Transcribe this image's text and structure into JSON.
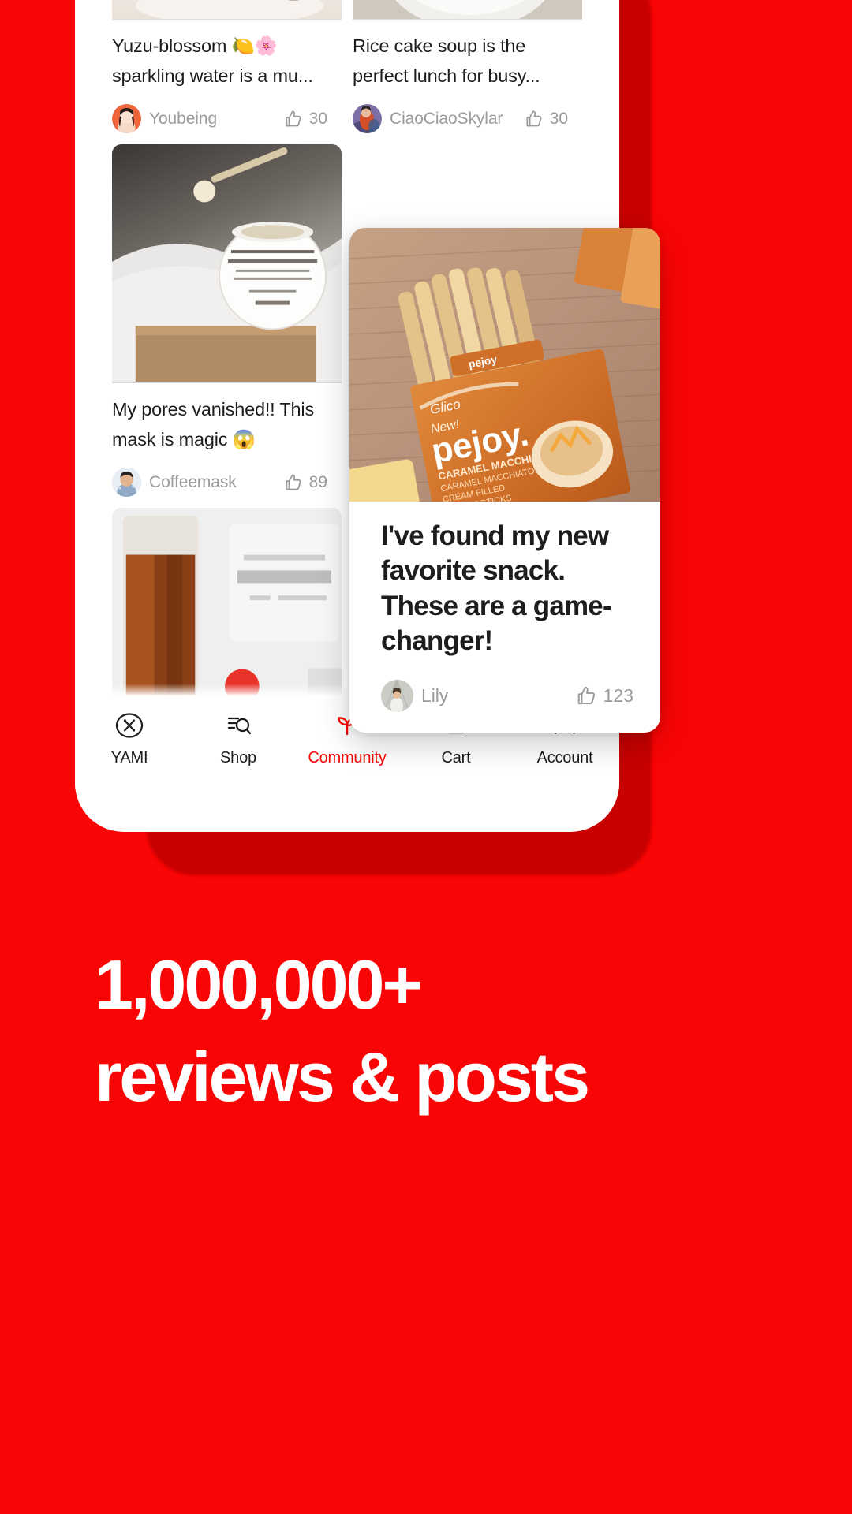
{
  "theme": {
    "background": "#FA0505",
    "accent": "#FA0505",
    "card_bg": "#FFFFFF",
    "text": "#1D1D1F",
    "muted": "#9B9B9E"
  },
  "feed": {
    "columns": [
      {
        "cards": [
          {
            "id": "yuzu-blossom",
            "image_name": "sparkling-water-glass-photo",
            "title": "Yuzu-blossom 🍋🌸 sparkling water is a mu...",
            "author": "Youbeing",
            "avatar_name": "avatar-youbeing",
            "likes": "30",
            "like_icon": "thumbs-up-icon"
          },
          {
            "id": "black-tea-mask",
            "image_name": "black-tea-instant-perfecting-mask-photo",
            "title": "My pores vanished!! This mask is magic 😱",
            "author": "Coffeemask",
            "avatar_name": "avatar-coffeemask",
            "likes": "89",
            "like_icon": "thumbs-up-icon"
          },
          {
            "id": "super-coffee",
            "image_name": "iced-super-coffee-photo",
            "title": "",
            "author": "",
            "avatar_name": "",
            "likes": "",
            "like_icon": "thumbs-up-icon"
          }
        ]
      },
      {
        "cards": [
          {
            "id": "rice-cake-soup",
            "image_name": "rice-cake-soup-bowl-photo",
            "title": "Rice cake soup is the perfect lunch for busy...",
            "author": "CiaoCiaoSkylar",
            "avatar_name": "avatar-ciaociaoskylar",
            "likes": "30",
            "like_icon": "thumbs-up-icon"
          }
        ]
      }
    ]
  },
  "featured_post": {
    "id": "pejoy-snack",
    "image_name": "pejoy-caramel-macchiato-biscuit-sticks-photo",
    "title": "I've found my new favorite snack. These are a game-changer!",
    "author": "Lily",
    "avatar_name": "avatar-lily",
    "likes": "123",
    "like_icon": "thumbs-up-icon"
  },
  "tabbar": {
    "items": [
      {
        "id": "yami",
        "label": "YAMI",
        "icon": "yami-logo-icon",
        "active": false
      },
      {
        "id": "shop",
        "label": "Shop",
        "icon": "search-filter-icon",
        "active": false
      },
      {
        "id": "community",
        "label": "Community",
        "icon": "sprout-icon",
        "active": true
      },
      {
        "id": "cart",
        "label": "Cart",
        "icon": "basket-icon",
        "active": false
      },
      {
        "id": "account",
        "label": "Account",
        "icon": "person-icon",
        "active": false
      }
    ]
  },
  "headline": {
    "line1": "1,000,000+",
    "line2": "reviews & posts"
  }
}
